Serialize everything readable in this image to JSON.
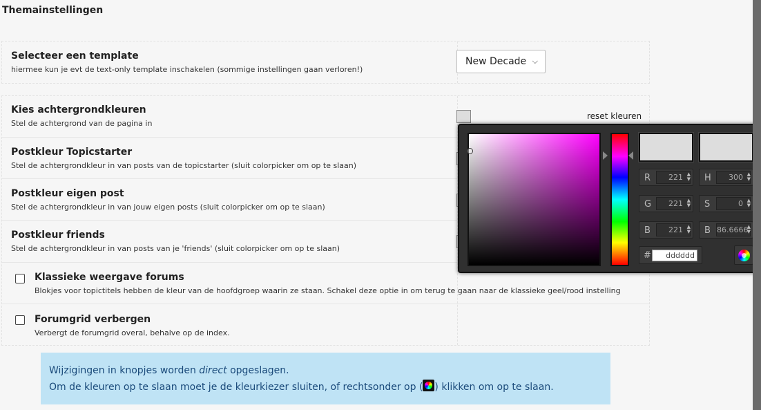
{
  "page": {
    "title": "Themainstellingen"
  },
  "template": {
    "title": "Selecteer een template",
    "description": "hiermee kun je evt de text-only template inschakelen (sommige instellingen gaan verloren!)",
    "selected": "New Decade"
  },
  "colors": {
    "reset_label": "reset kleuren",
    "rows": [
      {
        "title": "Kies achtergrondkleuren",
        "description": "Stel de achtergrond van de pagina in"
      },
      {
        "title": "Postkleur Topicstarter",
        "description": "Stel de achtergrondkleur in van posts van de topicstarter (sluit colorpicker om op te slaan)"
      },
      {
        "title": "Postkleur eigen post",
        "description": "Stel de achtergrondkleur in van jouw eigen posts (sluit colorpicker om op te slaan)"
      },
      {
        "title": "Postkleur friends",
        "description": "Stel de achtergrondkleur in van posts van je 'friends' (sluit colorpicker om op te slaan)"
      }
    ]
  },
  "options": [
    {
      "title": "Klassieke weergave forums",
      "description": "Blokjes voor topictitels hebben de kleur van de hoofdgroep waarin ze staan. Schakel deze optie in om terug te gaan naar de klassieke geel/rood instelling",
      "checked": false
    },
    {
      "title": "Forumgrid verbergen",
      "description": "Verbergt de forumgrid overal, behalve op de index.",
      "checked": false
    }
  ],
  "colorpicker": {
    "current_color": "#dddddd",
    "original_color": "#dddddd",
    "hue_gradient_top": "#ff00ff",
    "r_label": "R",
    "r": "221",
    "g_label": "G",
    "g": "221",
    "b_label": "B",
    "b": "221",
    "h_label": "H",
    "h": "300",
    "s_label": "S",
    "s": "0",
    "bright_label": "B",
    "bright": "86.6666",
    "hex_label": "#",
    "hex": "dddddd",
    "submit_icon": "color-wheel-icon"
  },
  "info": {
    "line1_before": "Wijzigingen in knopjes worden ",
    "line1_em": "direct",
    "line1_after": " opgeslagen.",
    "line2_before": "Om de kleuren op te slaan moet je de kleurkiezer sluiten, of rechtsonder op (",
    "line2_after": ") klikken om op te slaan."
  }
}
